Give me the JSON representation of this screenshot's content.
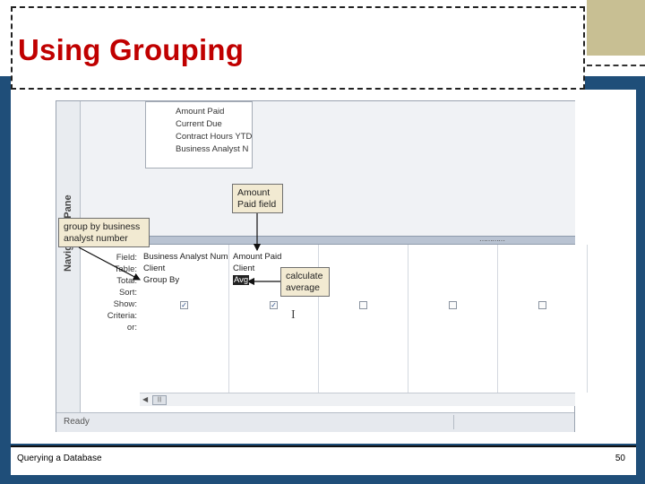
{
  "slide": {
    "title": "Using Grouping",
    "footer_left": "Querying a Database",
    "page_number": "50"
  },
  "access": {
    "nav_pane_label": "Navigation Pane",
    "field_list": [
      "Amount Paid",
      "Current Due",
      "Contract Hours YTD",
      "Business Analyst N"
    ],
    "row_labels": [
      "Field:",
      "Table:",
      "Total:",
      "Sort:",
      "Show:",
      "Criteria:",
      "or:"
    ],
    "columns": [
      {
        "field": "Business Analyst Num",
        "table": "Client",
        "total": "Group By",
        "show_checked": true
      },
      {
        "field": "Amount Paid",
        "table": "Client",
        "total": "Avg",
        "show_checked": true
      },
      {
        "field": "",
        "table": "",
        "total": "",
        "show_checked": false
      },
      {
        "field": "",
        "table": "",
        "total": "",
        "show_checked": false
      },
      {
        "field": "",
        "table": "",
        "total": "",
        "show_checked": false
      }
    ],
    "status": "Ready",
    "splitter_grip": "⋯⋯⋯⋯",
    "scroll_thumb": "|||"
  },
  "callouts": {
    "amount_paid": "Amount Paid field",
    "group_by": "group by business analyst number",
    "calculate": "calculate average"
  },
  "colors": {
    "title": "#c00000",
    "band": "#1f4e79",
    "accent": "#c8bf93",
    "callout_bg": "#f2ead2"
  }
}
